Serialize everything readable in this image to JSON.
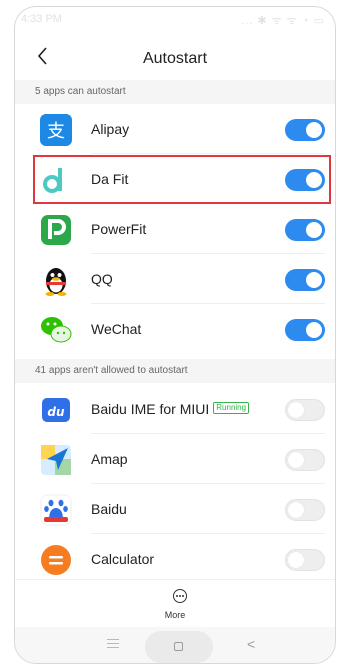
{
  "status_bar": {
    "time": "4:33 PM",
    "icons": "... ✱ ᯤ ᯤ ◔ ▭"
  },
  "header": {
    "title": "Autostart"
  },
  "sections": {
    "allowed_label": "5 apps can autostart",
    "denied_label": "41 apps aren't allowed to autostart"
  },
  "allowed_apps": [
    {
      "name": "Alipay",
      "enabled": true
    },
    {
      "name": "Da Fit",
      "enabled": true
    },
    {
      "name": "PowerFit",
      "enabled": true
    },
    {
      "name": "QQ",
      "enabled": true
    },
    {
      "name": "WeChat",
      "enabled": true
    }
  ],
  "denied_apps": [
    {
      "name": "Baidu IME for MIUI",
      "badge": "Running",
      "enabled": false
    },
    {
      "name": "Amap",
      "enabled": false
    },
    {
      "name": "Baidu",
      "enabled": false
    },
    {
      "name": "Calculator",
      "enabled": false
    }
  ],
  "bottom_bar": {
    "more_label": "More"
  },
  "colors": {
    "toggle_on": "#2d8bf0",
    "highlight": "#e0373f",
    "running_badge": "#37b34a"
  }
}
